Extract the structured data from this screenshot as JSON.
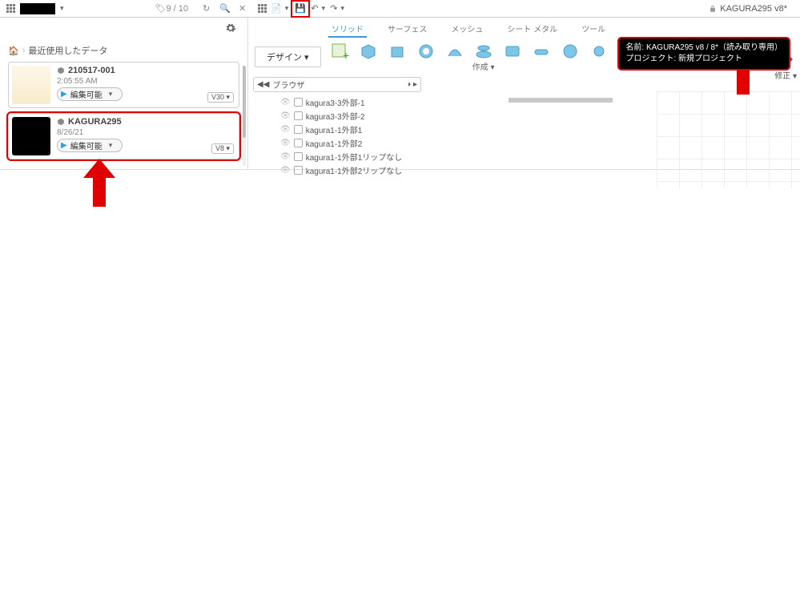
{
  "topbar": {
    "credit_icon_label": "9 / 10",
    "doc_tab": "KAGURA295 v8*"
  },
  "qat": {
    "undo_caret": "▾",
    "redo_caret": "▾"
  },
  "panel": {
    "breadcrumb": "最近使用したデータ",
    "cards": [
      {
        "title": "210517-001",
        "sub": "2:05:55 AM",
        "edit": "編集可能",
        "ver": "V30 ▾"
      },
      {
        "title": "KAGURA295",
        "sub": "8/26/21",
        "edit": "編集可能",
        "ver": "V8 ▾"
      }
    ]
  },
  "ribbon": {
    "design_btn": "デザイン ▾",
    "tabs": [
      "ソリッド",
      "サーフェス",
      "メッシュ",
      "シート メタル",
      "ツール"
    ],
    "group_label": "作成 ▾",
    "fix_label": "修正 ▾"
  },
  "tooltip": {
    "line1": "名前: KAGURA295 v8 / 8*（読み取り専用）",
    "line2": "プロジェクト: 新規プロジェクト"
  },
  "browser": {
    "label": "ブラウザ"
  },
  "tree": [
    "kagura3-3外部-1",
    "kagura3-3外部-2",
    "kagura1-1外部1",
    "kagura1-1外部2",
    "kagura1-1外部1リップなし",
    "kagura1-1外部2リップなし"
  ]
}
